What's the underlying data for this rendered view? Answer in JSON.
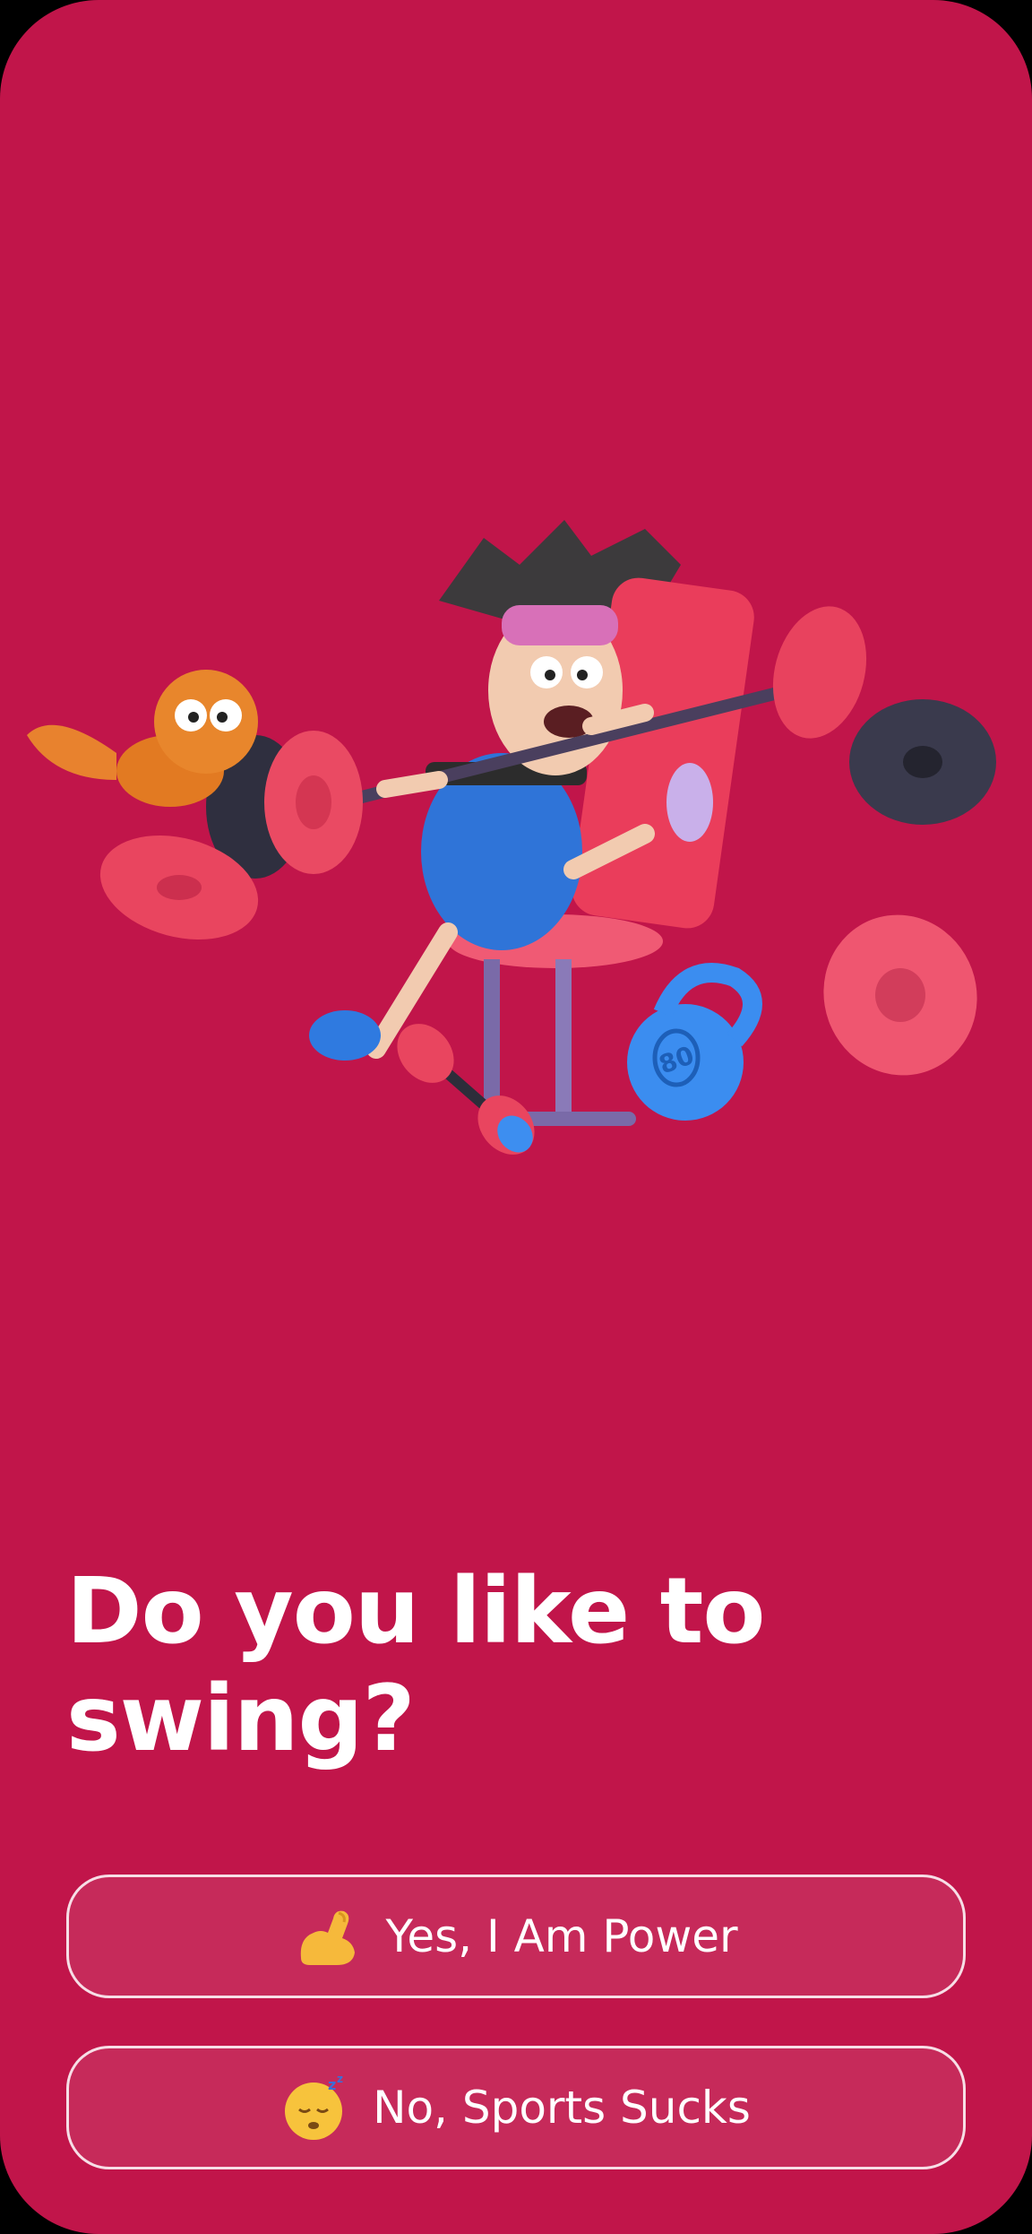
{
  "question": {
    "title": "Do you like to swing?"
  },
  "answers": [
    {
      "label": "Yes, I Am Power",
      "icon": "flexed-biceps-emoji"
    },
    {
      "label": "No, Sports Sucks",
      "icon": "sleeping-face-emoji"
    }
  ],
  "illustration": {
    "icon": "cartoon-weightlifter-with-cat-illustration",
    "kettlebell_label": "80"
  },
  "colors": {
    "background": "#c1154a",
    "text": "#ffffff",
    "button_border": "#ffffff"
  }
}
